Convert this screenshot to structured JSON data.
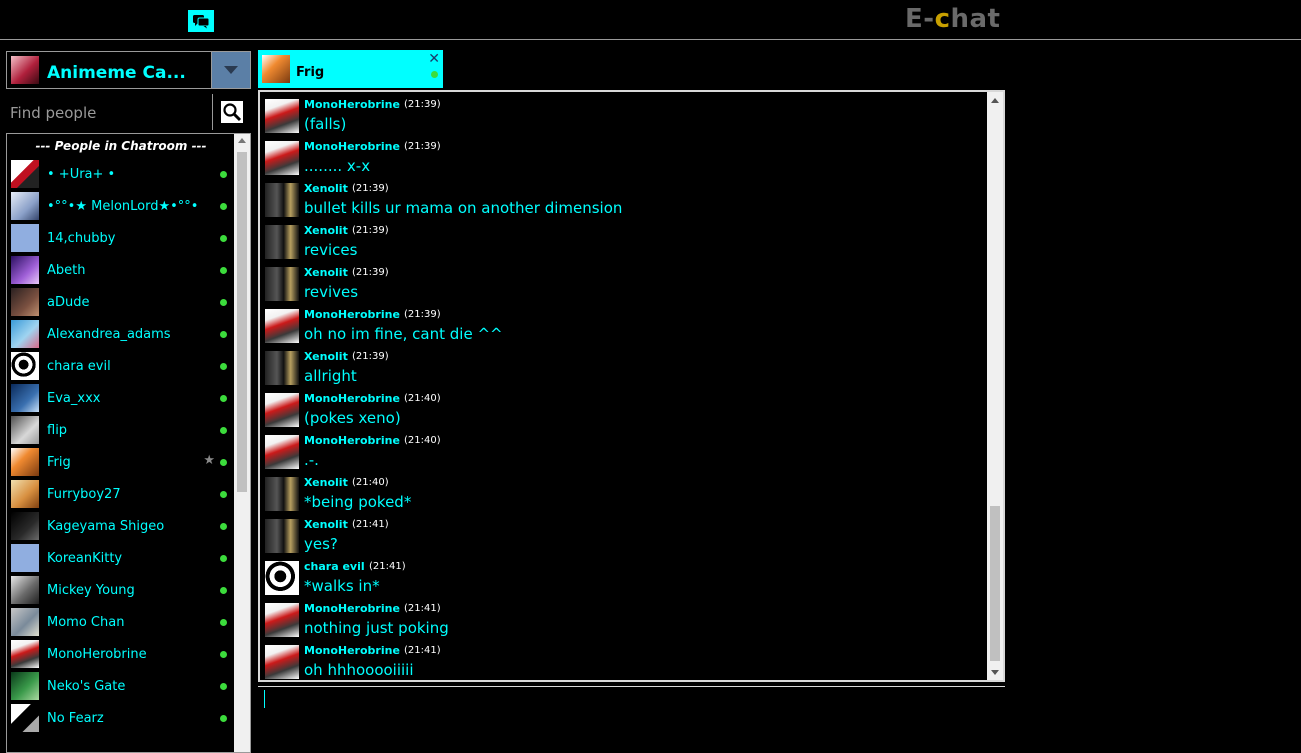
{
  "header": {
    "logo_prefix": "E-",
    "logo_c": "c",
    "logo_suffix": "hat",
    "chat_toggle_icon": "chat-bubbles-icon"
  },
  "room": {
    "name": "Animeme Ca...",
    "dropdown_icon": "chevron-down-icon"
  },
  "search": {
    "placeholder": "Find people",
    "icon": "search-icon"
  },
  "people": {
    "header": "--- People in Chatroom ---",
    "items": [
      {
        "name": "• +Ura+ •",
        "avatar": "av-ura",
        "status": "online"
      },
      {
        "name": "•°°•★ MelonLord★•°°•",
        "avatar": "av-melon",
        "status": "online"
      },
      {
        "name": "14,chubby",
        "avatar": "av-default",
        "status": "online"
      },
      {
        "name": "Abeth",
        "avatar": "av-abeth",
        "status": "online"
      },
      {
        "name": "aDude",
        "avatar": "av-adude",
        "status": "online"
      },
      {
        "name": "Alexandrea_adams",
        "avatar": "av-alex",
        "status": "online"
      },
      {
        "name": "chara evil",
        "avatar": "av-chara",
        "status": "online"
      },
      {
        "name": "Eva_xxx",
        "avatar": "av-eva",
        "status": "online"
      },
      {
        "name": "flip",
        "avatar": "av-flip",
        "status": "online"
      },
      {
        "name": "Frig",
        "avatar": "av-frig",
        "status": "online",
        "star": "★"
      },
      {
        "name": "Furryboy27",
        "avatar": "av-furry",
        "status": "online"
      },
      {
        "name": "Kageyama Shigeo",
        "avatar": "av-kage",
        "status": "online"
      },
      {
        "name": "KoreanKitty",
        "avatar": "av-default",
        "status": "online"
      },
      {
        "name": "Mickey Young",
        "avatar": "av-mickey",
        "status": "online"
      },
      {
        "name": "Momo Chan",
        "avatar": "av-momo",
        "status": "online"
      },
      {
        "name": "MonoHerobrine",
        "avatar": "av-mono",
        "status": "online"
      },
      {
        "name": "Neko's Gate",
        "avatar": "av-neko",
        "status": "online"
      },
      {
        "name": "No Fearz",
        "avatar": "av-nofear",
        "status": "online"
      }
    ]
  },
  "tab": {
    "name": "Frig",
    "close_icon": "close-icon",
    "close_label": "✕",
    "status": "online"
  },
  "messages": [
    {
      "author": "MonoHerobrine",
      "time": "(21:39)",
      "text": "(falls)",
      "avatar": "av-mono"
    },
    {
      "author": "MonoHerobrine",
      "time": "(21:39)",
      "text": "........ x-x",
      "avatar": "av-mono"
    },
    {
      "author": "Xenolit",
      "time": "(21:39)",
      "text": "bullet kills ur mama on another dimension",
      "avatar": "av-xeno"
    },
    {
      "author": "Xenolit",
      "time": "(21:39)",
      "text": "revices",
      "avatar": "av-xeno"
    },
    {
      "author": "Xenolit",
      "time": "(21:39)",
      "text": "revives",
      "avatar": "av-xeno"
    },
    {
      "author": "MonoHerobrine",
      "time": "(21:39)",
      "text": "oh no im fine, cant die ^^",
      "avatar": "av-mono"
    },
    {
      "author": "Xenolit",
      "time": "(21:39)",
      "text": "allright",
      "avatar": "av-xeno"
    },
    {
      "author": "MonoHerobrine",
      "time": "(21:40)",
      "text": "(pokes xeno)",
      "avatar": "av-mono"
    },
    {
      "author": "MonoHerobrine",
      "time": "(21:40)",
      "text": ".-.",
      "avatar": "av-mono"
    },
    {
      "author": "Xenolit",
      "time": "(21:40)",
      "text": "*being poked*",
      "avatar": "av-xeno"
    },
    {
      "author": "Xenolit",
      "time": "(21:41)",
      "text": "yes?",
      "avatar": "av-xeno"
    },
    {
      "author": "chara evil",
      "time": "(21:41)",
      "text": "*walks in*",
      "avatar": "av-chara"
    },
    {
      "author": "MonoHerobrine",
      "time": "(21:41)",
      "text": "nothing just poking",
      "avatar": "av-mono"
    },
    {
      "author": "MonoHerobrine",
      "time": "(21:41)",
      "text": "oh hhhooooiiiii",
      "avatar": "av-mono"
    }
  ],
  "composer": {
    "value": ""
  }
}
